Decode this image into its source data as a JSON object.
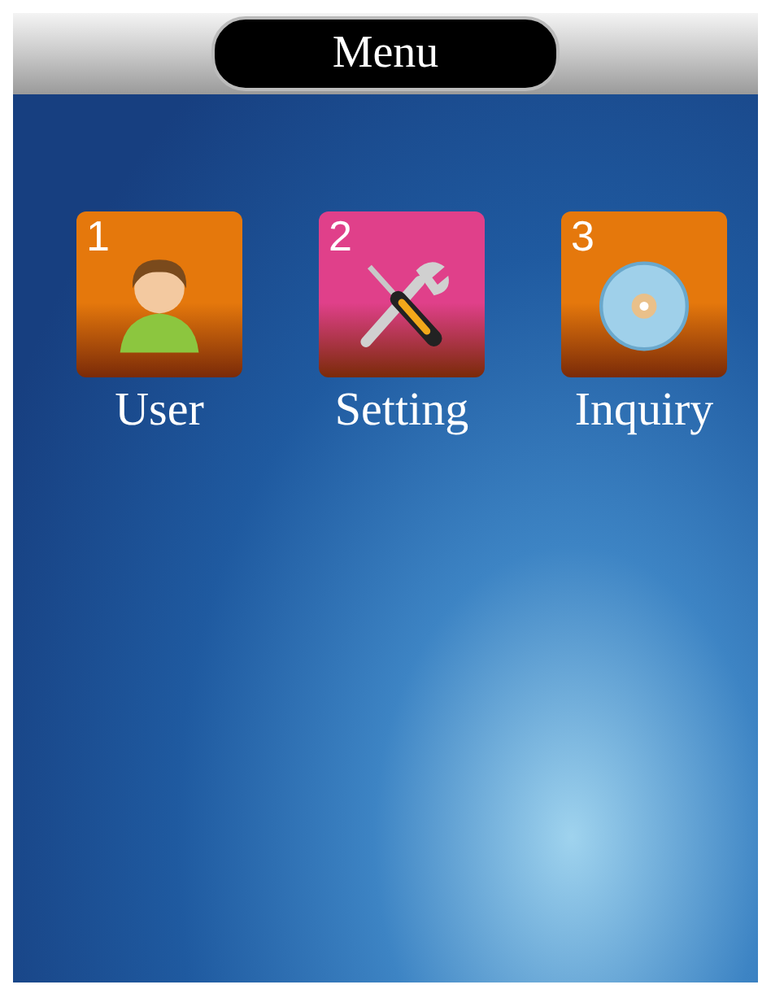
{
  "title": "Menu",
  "items": [
    {
      "number": "1",
      "label": "User",
      "kind": "user",
      "color": "#e5780c"
    },
    {
      "number": "2",
      "label": "Setting",
      "kind": "tools",
      "color": "#e0408a"
    },
    {
      "number": "3",
      "label": "Inquiry",
      "kind": "disc",
      "color": "#e5780c"
    }
  ]
}
